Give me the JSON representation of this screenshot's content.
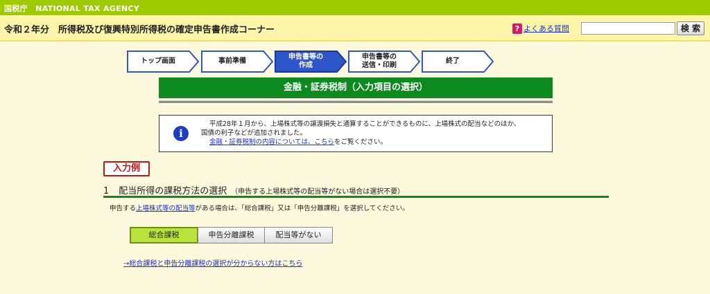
{
  "agency": "国税庁　NATIONAL TAX AGENCY",
  "header": {
    "title": "令和２年分　所得税及び復興特別所得税の確定申告書作成コーナー",
    "faq_icon": "?",
    "faq_label": "よくある質問",
    "search_value": "",
    "search_button": "検 索"
  },
  "steps": [
    {
      "line1": "トップ画面",
      "line2": "",
      "state": "done"
    },
    {
      "line1": "事前準備",
      "line2": "",
      "state": "done"
    },
    {
      "line1": "申告書等の",
      "line2": "作成",
      "state": "active"
    },
    {
      "line1": "申告書等の",
      "line2": "送信・印刷",
      "state": "todo"
    },
    {
      "line1": "終了",
      "line2": "",
      "state": "todo"
    }
  ],
  "section": {
    "title": "金融・証券税制（入力項目の選択）"
  },
  "info": {
    "icon": "i",
    "line1": "平成28年１月から、上場株式等の譲渡損失と通算することができるものに、上場株式の配当などのほか、",
    "line2": "国債の利子などが追加されました。",
    "link": "金融・証券税制の内容については、こちら",
    "link_suffix": "をご覧ください。"
  },
  "example_badge": "入力例",
  "question": {
    "number": "1",
    "title": "配当所得の課税方法の選択",
    "note": "（申告する上場株式等の配当等がない場合は選択不要）",
    "desc_prefix": "申告する",
    "desc_link": "上場株式等の配当等",
    "desc_suffix": "がある場合は、「総合課税」又は「申告分離課税」を選択してください。",
    "options": [
      "総合課税",
      "申告分離課税",
      "配当等がない"
    ],
    "selected": "総合課税",
    "help_link": "→総合課税と申告分離課税の選択が分からない方はこちら"
  },
  "colors": {
    "top_bar": "#9fca00",
    "header_bg": "#fdf6a9",
    "page_bg": "#fdf9dd",
    "section_green": "#0d8a1e",
    "step_blue": "#2f56c8",
    "selected_option": "#b7e33a",
    "example_red": "#cc1111",
    "link_blue": "#1a2fd0"
  }
}
